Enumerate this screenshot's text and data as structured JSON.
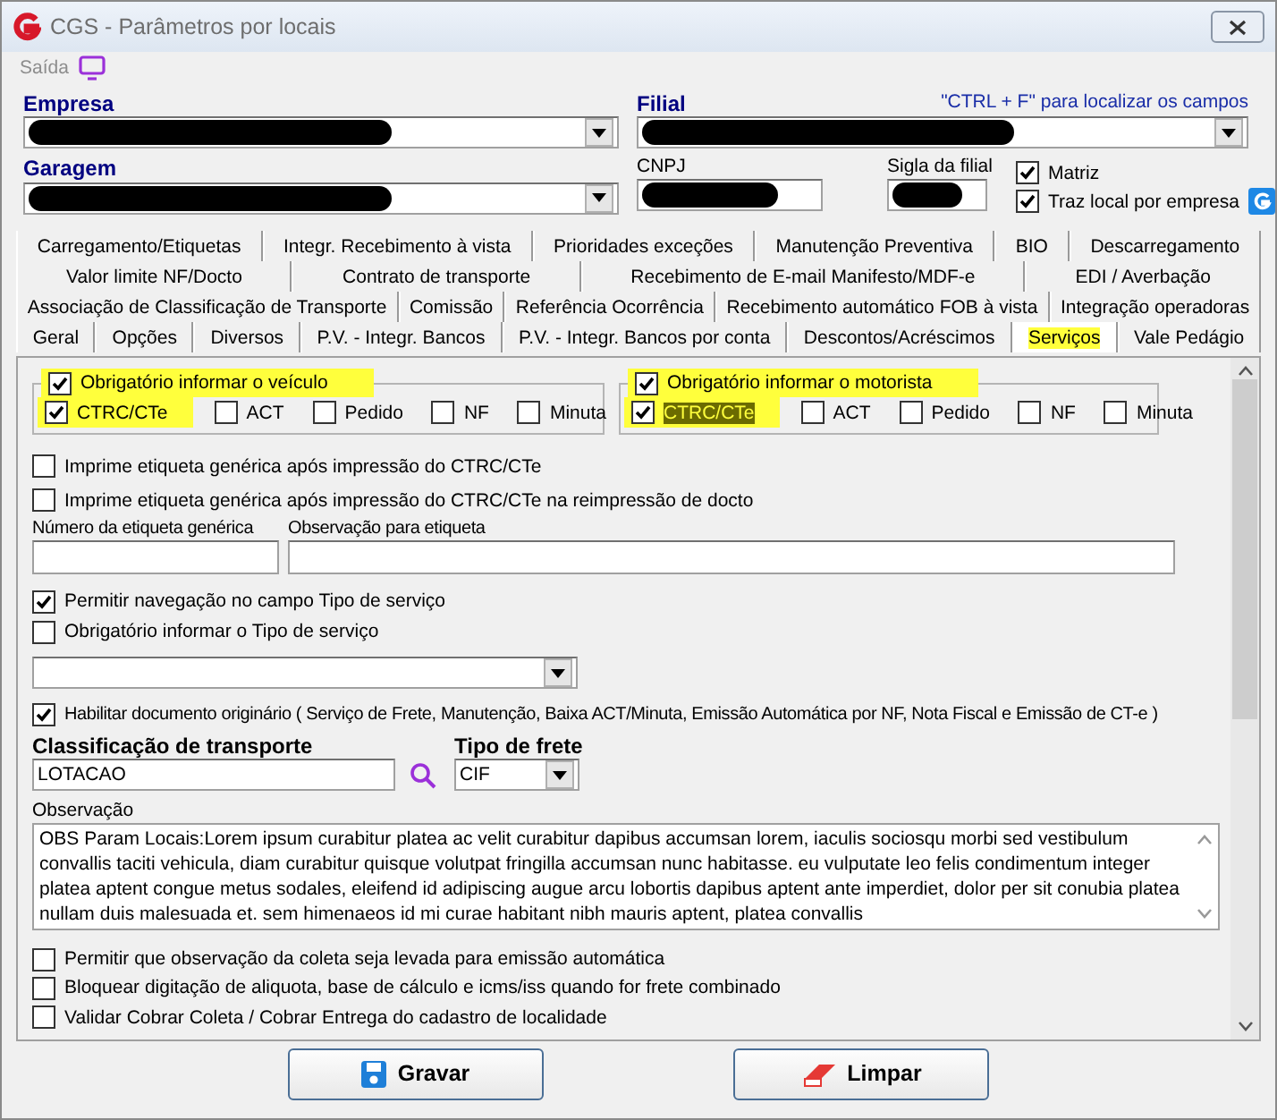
{
  "window": {
    "title": "CGS - Parâmetros por locais"
  },
  "menu": [
    {
      "label": "Saída",
      "disabled": true
    }
  ],
  "header": {
    "empresa": {
      "label": "Empresa",
      "redacted": true
    },
    "filial": {
      "label": "Filial",
      "redacted": true
    },
    "hint": "\"CTRL + F\" para localizar os campos",
    "garagem": {
      "label": "Garagem",
      "redacted": true
    },
    "cnpj": {
      "label": "CNPJ",
      "redacted": true
    },
    "sigla": {
      "label": "Sigla da filial",
      "redacted": true
    },
    "checks": [
      {
        "label": "Matriz",
        "checked": true
      },
      {
        "label": "Traz local por empresa",
        "checked": true
      }
    ]
  },
  "tab_rows": [
    {
      "tabs": [
        {
          "label": "Carregamento/Etiquetas",
          "selected": false
        },
        {
          "label": "Integr. Recebimento à vista",
          "selected": false
        },
        {
          "label": "Prioridades exceções",
          "selected": false
        },
        {
          "label": "Manutenção Preventiva",
          "selected": false
        },
        {
          "label": "BIO",
          "selected": false
        },
        {
          "label": "Descarregamento",
          "selected": false
        }
      ]
    },
    {
      "tabs": [
        {
          "label": "Valor limite NF/Docto",
          "selected": false
        },
        {
          "label": "Contrato de transporte",
          "selected": false
        },
        {
          "label": "Recebimento de E-mail Manifesto/MDF-e",
          "selected": false
        },
        {
          "label": "EDI / Averbação",
          "selected": false
        }
      ]
    },
    {
      "tabs": [
        {
          "label": "Associação de Classificação de Transporte",
          "selected": false
        },
        {
          "label": "Comissão",
          "selected": false
        },
        {
          "label": "Referência Ocorrência",
          "selected": false
        },
        {
          "label": "Recebimento automático FOB à vista",
          "selected": false
        },
        {
          "label": "Integração operadoras",
          "selected": false
        }
      ]
    },
    {
      "tabs": [
        {
          "label": "Geral",
          "selected": false
        },
        {
          "label": "Opções",
          "selected": false
        },
        {
          "label": "Diversos",
          "selected": false
        },
        {
          "label": "P.V. - Integr. Bancos",
          "selected": false
        },
        {
          "label": "P.V. - Integr. Bancos por conta",
          "selected": false
        },
        {
          "label": "Descontos/Acréscimos",
          "selected": false
        },
        {
          "label": "Serviços",
          "selected": true,
          "highlighted": true
        },
        {
          "label": "Vale Pedágio",
          "selected": false
        }
      ]
    }
  ],
  "groups": [
    {
      "title": "Obrigatório informar o veículo",
      "checked": true,
      "highlighted": true,
      "options": [
        {
          "label": "CTRC/CTe",
          "checked": true,
          "highlighted": true,
          "focused": false
        },
        {
          "label": "ACT",
          "checked": false,
          "highlighted": false,
          "focused": false
        },
        {
          "label": "Pedido",
          "checked": false,
          "highlighted": false,
          "focused": false
        },
        {
          "label": "NF",
          "checked": false,
          "highlighted": false,
          "focused": false
        },
        {
          "label": "Minuta",
          "checked": false,
          "highlighted": false,
          "focused": false
        }
      ]
    },
    {
      "title": "Obrigatório informar o motorista",
      "checked": true,
      "highlighted": true,
      "options": [
        {
          "label": "CTRC/CTe",
          "checked": true,
          "highlighted": true,
          "focused": true
        },
        {
          "label": "ACT",
          "checked": false,
          "highlighted": false,
          "focused": false
        },
        {
          "label": "Pedido",
          "checked": false,
          "highlighted": false,
          "focused": false
        },
        {
          "label": "NF",
          "checked": false,
          "highlighted": false,
          "focused": false
        },
        {
          "label": "Minuta",
          "checked": false,
          "highlighted": false,
          "focused": false
        }
      ]
    }
  ],
  "panel_items": [
    {
      "kind": "checkbox",
      "label": "Imprime etiqueta genérica após impressão do CTRC/CTe",
      "checked": false
    },
    {
      "kind": "checkbox",
      "label": "Imprime etiqueta genérica após impressão do CTRC/CTe na reimpressão de docto",
      "checked": false
    },
    {
      "kind": "fields",
      "fields": [
        {
          "label": "Número da etiqueta genérica"
        },
        {
          "label": "Observação para etiqueta"
        }
      ]
    },
    {
      "kind": "checkbox",
      "label": "Permitir navegação no campo Tipo de serviço",
      "checked": true
    },
    {
      "kind": "checkbox",
      "label": "Obrigatório informar o Tipo de serviço",
      "checked": false
    },
    {
      "kind": "select"
    },
    {
      "kind": "checkbox",
      "label": "Habilitar documento originário ( Serviço de Frete, Manutenção, Baixa ACT/Minuta, Emissão Automática por NF, Nota Fiscal e Emissão de CT-e )",
      "checked": true
    },
    {
      "kind": "lookup",
      "label": "Classificação de transporte",
      "value": "LOTACAO",
      "select_label": "Tipo de frete",
      "select_value": "CIF"
    },
    {
      "kind": "textarea",
      "label": "Observação",
      "value": "OBS Param Locais:Lorem ipsum curabitur platea ac velit curabitur dapibus accumsan lorem, iaculis sociosqu morbi sed vestibulum convallis taciti vehicula, diam curabitur quisque volutpat fringilla accumsan nunc habitasse. eu vulputate leo felis condimentum integer platea aptent congue metus sodales, eleifend id adipiscing augue arcu lobortis dapibus aptent ante imperdiet, dolor per sit conubia platea nullam duis malesuada et. sem himenaeos id mi curae habitant nibh mauris aptent, platea convallis"
    },
    {
      "kind": "checkbox",
      "label": "Permitir que observação da coleta seja levada para emissão automática",
      "checked": false
    },
    {
      "kind": "checkbox",
      "label": "Bloquear digitação de aliquota, base de cálculo e icms/iss quando for frete combinado",
      "checked": false
    },
    {
      "kind": "checkbox",
      "label": "Validar Cobrar Coleta / Cobrar Entrega do cadastro de localidade",
      "checked": false
    }
  ],
  "buttons": [
    {
      "label": "Gravar",
      "kind": "save"
    },
    {
      "label": "Limpar",
      "kind": "clear"
    }
  ]
}
